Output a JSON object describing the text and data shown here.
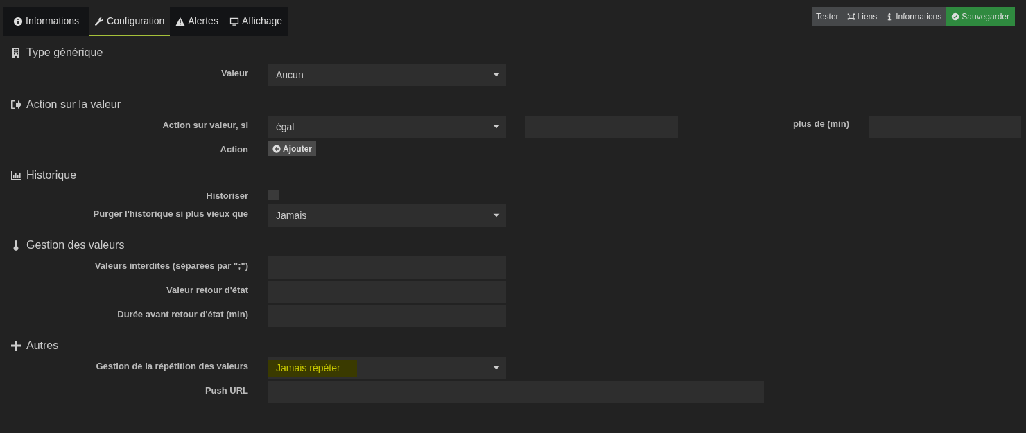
{
  "tabs": [
    {
      "label": "Informations",
      "selected": false
    },
    {
      "label": "Configuration",
      "selected": true
    },
    {
      "label": "Alertes",
      "selected": false
    },
    {
      "label": "Affichage",
      "selected": false
    }
  ],
  "actions": [
    {
      "label": "Tester",
      "kind": "plain"
    },
    {
      "label": "Liens",
      "kind": "plain"
    },
    {
      "label": "Informations",
      "kind": "plain"
    },
    {
      "label": "Sauvegarder",
      "kind": "success"
    }
  ],
  "sections": [
    {
      "title": "Type générique",
      "rows": [
        {
          "label": "Valeur",
          "controls": [
            {
              "kind": "select",
              "value": "Aucun"
            }
          ]
        }
      ]
    },
    {
      "title": "Action sur la valeur",
      "rows": [
        {
          "label": "Action sur valeur, si",
          "controls": [
            {
              "kind": "select",
              "value": "égal"
            },
            {
              "kind": "input"
            },
            {
              "kind": "label",
              "text": "plus de (min)"
            },
            {
              "kind": "input"
            }
          ]
        },
        {
          "label": "Action",
          "controls": [
            {
              "kind": "button",
              "text": "Ajouter"
            }
          ]
        }
      ]
    },
    {
      "title": "Historique",
      "rows": [
        {
          "label": "Historiser",
          "controls": [
            {
              "kind": "checkbox",
              "checked": false
            }
          ]
        },
        {
          "label": "Purger l'historique si plus vieux que",
          "controls": [
            {
              "kind": "select",
              "value": "Jamais"
            }
          ]
        }
      ]
    },
    {
      "title": "Gestion des valeurs",
      "rows": [
        {
          "label": "Valeurs interdites (séparées par \";\")",
          "controls": [
            {
              "kind": "input"
            }
          ]
        },
        {
          "label": "Valeur retour d'état",
          "controls": [
            {
              "kind": "input"
            }
          ]
        },
        {
          "label": "Durée avant retour d'état (min)",
          "controls": [
            {
              "kind": "input"
            }
          ]
        }
      ]
    },
    {
      "title": "Autres",
      "rows": [
        {
          "label": "Gestion de la répétition des valeurs",
          "controls": [
            {
              "kind": "select",
              "value": "Jamais répéter",
              "highlighted": true
            }
          ]
        },
        {
          "label": "Push URL",
          "controls": [
            {
              "kind": "input",
              "wide": true
            }
          ]
        }
      ]
    }
  ]
}
